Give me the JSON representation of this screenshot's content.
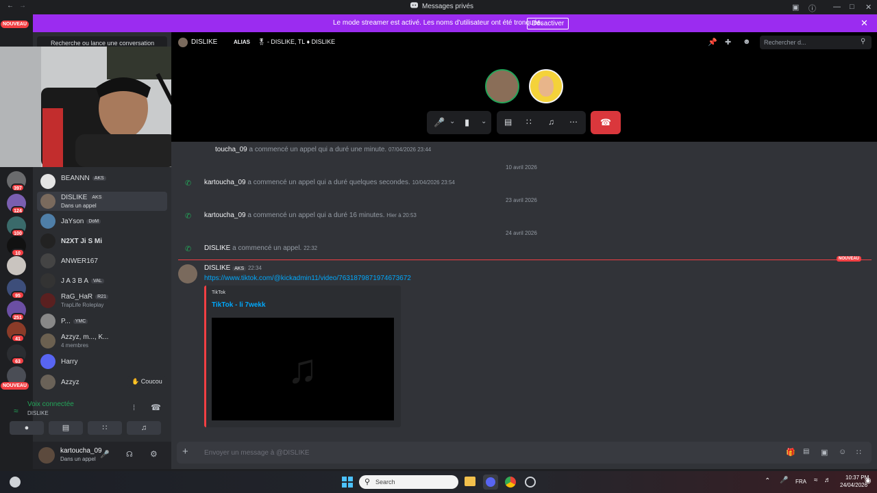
{
  "titlebar": {
    "title": "Messages privés"
  },
  "banner": {
    "text": "Le mode streamer est activé. Les noms d'utilisateur ont été tronqués.",
    "button": "Désactiver"
  },
  "rail": {
    "new_top": "NOUVEAU",
    "new_bottom": "NOUVEAU",
    "badges": [
      "397",
      "124",
      "100",
      "10",
      "95",
      "251",
      "41",
      "63"
    ]
  },
  "sidebar": {
    "search": "Recherche ou lance une conversation",
    "dms": [
      {
        "name": "BEANNN",
        "tag": "AKS",
        "sub": ""
      },
      {
        "name": "DISLIKE",
        "tag": "AKS",
        "sub": "Dans un appel"
      },
      {
        "name": "JaYson",
        "tag": "DoM",
        "sub": ""
      },
      {
        "name": "N2XT Ji S Mi",
        "tag": "",
        "sub": ""
      },
      {
        "name": "ANWER167",
        "tag": "",
        "sub": ""
      },
      {
        "name": "J A 3 B A",
        "tag": "VAL",
        "sub": ""
      },
      {
        "name": "RaG_HaR",
        "tag": "R21",
        "sub": "TrapLife Roleplay"
      },
      {
        "name": "P...",
        "tag": "YMC",
        "sub": ""
      },
      {
        "name": "Azzyz, m..., K...",
        "tag": "",
        "sub": "4 membres"
      },
      {
        "name": "Harry",
        "tag": "",
        "sub": ""
      },
      {
        "name": "Azzyz",
        "tag": "",
        "sub": ""
      }
    ],
    "coucou": "Coucou"
  },
  "voice": {
    "status": "Voix connectée",
    "channel": "DISLIKE"
  },
  "userbar": {
    "name": "kartoucha_09",
    "status": "Dans un appel"
  },
  "topbar": {
    "name": "DISLIKE",
    "alias_label": "ALIAS",
    "aliases": "- DISLIKE, TL",
    "alias2": "DISLIKE",
    "search_placeholder": "Rechercher d..."
  },
  "messages": {
    "first": {
      "user": "toucha_09",
      "text": "a commencé un appel qui a duré une minute.",
      "ts": "07/04/2026 23:44"
    },
    "date1": "10 avril 2026",
    "m2": {
      "user": "kartoucha_09",
      "text": "a commencé un appel qui a duré quelques secondes.",
      "ts": "10/04/2026 23:54"
    },
    "date2": "23 avril 2026",
    "m3": {
      "user": "kartoucha_09",
      "text": "a commencé un appel qui a duré 16 minutes.",
      "ts": "Hier à 20:53"
    },
    "date3": "24 avril 2026",
    "m4": {
      "user": "DISLIKE",
      "text": "a commencé un appel.",
      "ts": "22:32"
    },
    "new_label": "NOUVEAU",
    "m5": {
      "user": "DISLIKE",
      "tag": "AKS",
      "ts": "22:34",
      "link": "https://www.tiktok.com/@kickadmin11/video/7631879871974673672",
      "embed_provider": "TikTok",
      "embed_title": "TikTok - li 7wekk"
    }
  },
  "composer": {
    "placeholder": "Envoyer un message à @DISLIKE"
  },
  "taskbar": {
    "search": "Search",
    "lang": "FRA",
    "time": "10:37 PM",
    "date": "24/04/2026"
  },
  "colors": {
    "accent": "#9b2cf0",
    "danger": "#da373c",
    "green": "#23a559",
    "link": "#00a8fc"
  }
}
